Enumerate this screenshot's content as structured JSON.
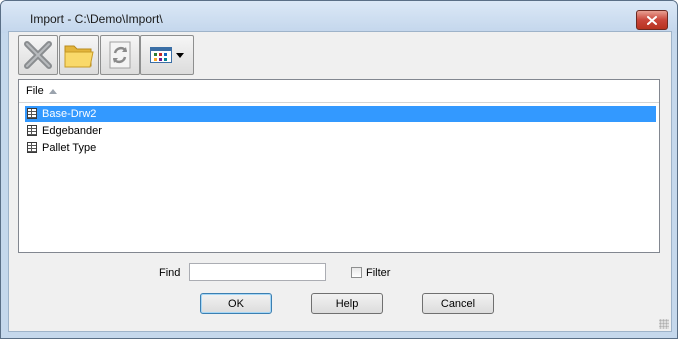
{
  "window": {
    "title": "Import - C:\\Demo\\Import\\",
    "close_icon": "close-icon"
  },
  "toolbar": {
    "buttons": [
      {
        "name": "delete-button",
        "icon": "x-icon"
      },
      {
        "name": "open-folder-button",
        "icon": "folder-icon"
      },
      {
        "name": "refresh-button",
        "icon": "refresh-icon"
      },
      {
        "name": "view-mode-button",
        "icon": "grid-view-icon",
        "dropdown": true
      }
    ]
  },
  "file_list": {
    "column_header": "File",
    "sort": "ascending",
    "items": [
      {
        "label": "Base-Drw2",
        "selected": true
      },
      {
        "label": "Edgebander",
        "selected": false
      },
      {
        "label": "Pallet Type",
        "selected": false
      }
    ]
  },
  "find": {
    "label": "Find",
    "value": ""
  },
  "filter": {
    "label": "Filter",
    "checked": false
  },
  "buttons": {
    "ok": "OK",
    "help": "Help",
    "cancel": "Cancel"
  },
  "colors": {
    "selection": "#3399ff",
    "close_button": "#c9463a",
    "dialog_background": "#f0f0f0"
  }
}
